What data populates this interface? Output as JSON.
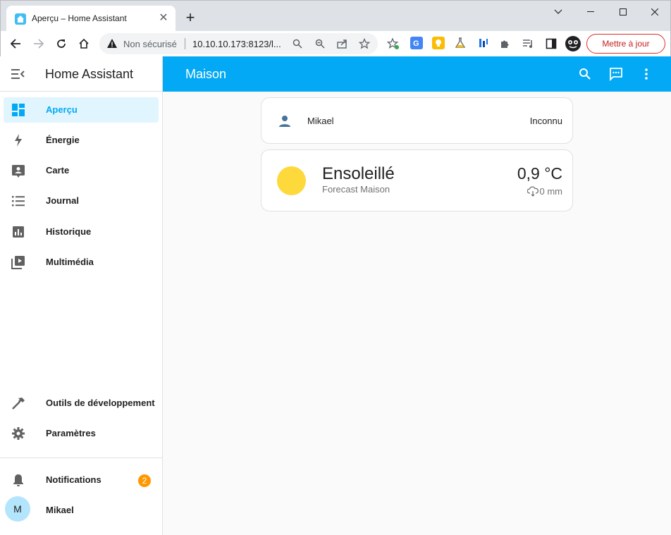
{
  "browser": {
    "tab_title": "Aperçu – Home Assistant",
    "new_tab": "+",
    "insecure_label": "Non sécurisé",
    "url": "10.10.10.173:8123/l...",
    "update_button": "Mettre à jour"
  },
  "sidebar": {
    "title": "Home Assistant",
    "items": [
      {
        "label": "Aperçu",
        "icon": "dashboard-icon",
        "active": true
      },
      {
        "label": "Énergie",
        "icon": "lightning-icon"
      },
      {
        "label": "Carte",
        "icon": "map-icon"
      },
      {
        "label": "Journal",
        "icon": "list-icon"
      },
      {
        "label": "Historique",
        "icon": "chart-icon"
      },
      {
        "label": "Multimédia",
        "icon": "media-icon"
      }
    ],
    "bottom_items": [
      {
        "label": "Outils de développement",
        "icon": "hammer-icon"
      },
      {
        "label": "Paramètres",
        "icon": "gear-icon"
      }
    ],
    "notifications": {
      "label": "Notifications",
      "count": "2"
    },
    "user": {
      "label": "Mikael",
      "initial": "M"
    }
  },
  "main": {
    "title": "Maison",
    "person_card": {
      "name": "Mikael",
      "state": "Inconnu"
    },
    "weather_card": {
      "state": "Ensoleillé",
      "name": "Forecast Maison",
      "temperature": "0,9 °C",
      "precipitation": "0 mm"
    }
  },
  "colors": {
    "primary": "#03a9f4",
    "active_bg": "#e1f5fe",
    "sun": "#fdd93c",
    "badge": "#ff9800",
    "update_red": "#d93025"
  }
}
